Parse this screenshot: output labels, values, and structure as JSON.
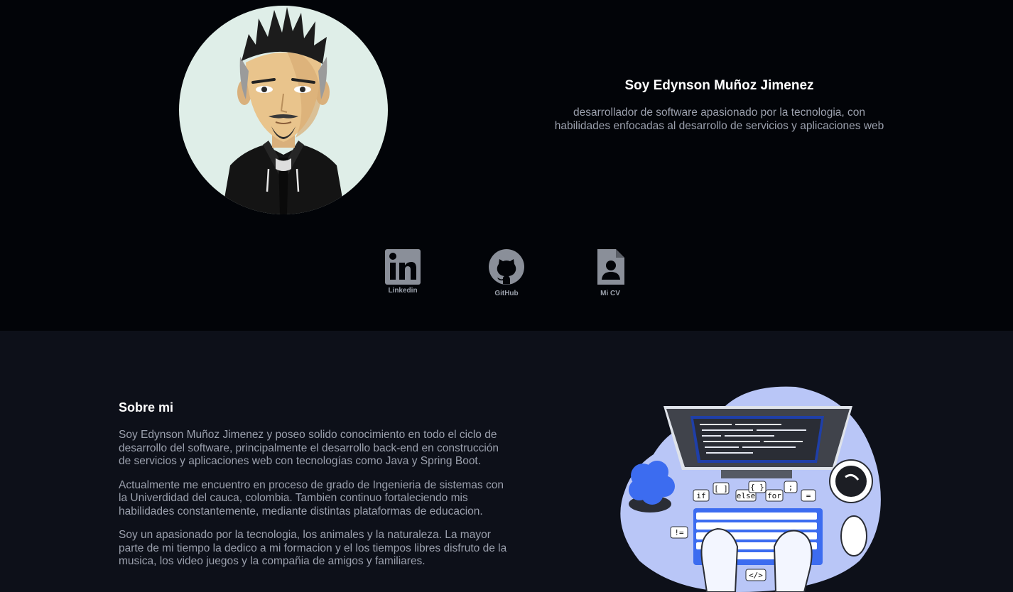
{
  "hero": {
    "avatar_alt": "avatar",
    "title": "Soy Edynson Muñoz Jimenez",
    "subtitle_line1": "desarrollador de software apasionado por la tecnologia, con",
    "subtitle_line2": "habilidades enfocadas al desarrollo de servicios y aplicaciones web"
  },
  "social": {
    "linkedin": {
      "label": "Linkedin",
      "icon": "linkedin-icon"
    },
    "github": {
      "label": "GitHub",
      "icon": "github-icon"
    },
    "cv": {
      "label": "Mi CV",
      "icon": "cv-icon"
    }
  },
  "about": {
    "title": "Sobre mi",
    "paragraphs": [
      "Soy Edynson Muñoz Jimenez y poseo solido conocimiento en todo el ciclo de desarrollo del software, principalmente el desarrollo back-end en construcción de servicios y aplicaciones web con tecnologías como Java y Spring Boot.",
      "Actualmente me encuentro en proceso de grado de Ingenieria de sistemas con la Univerdidad del cauca, colombia. Tambien continuo fortaleciendo mis habilidades constantemente, mediante distintas plataformas de educacion.",
      "Soy un apasionado por la tecnologia, los animales y la naturaleza. La mayor parte de mi tiempo la dedico a mi formacion y el los tiempos libres disfruto de la musica, los video juegos y la compañia de amigos y familiares."
    ]
  },
  "illustration": {
    "tokens": [
      "if",
      "[ ]",
      "else",
      "{ }",
      "for",
      ";",
      "=",
      "!=",
      "</>"
    ]
  },
  "colors": {
    "hero_bg": "#020408",
    "about_bg": "#0d1019",
    "icon_gray": "#8a8f99",
    "accent_blue": "#3c6cf0",
    "blob": "#b9c6f7"
  }
}
